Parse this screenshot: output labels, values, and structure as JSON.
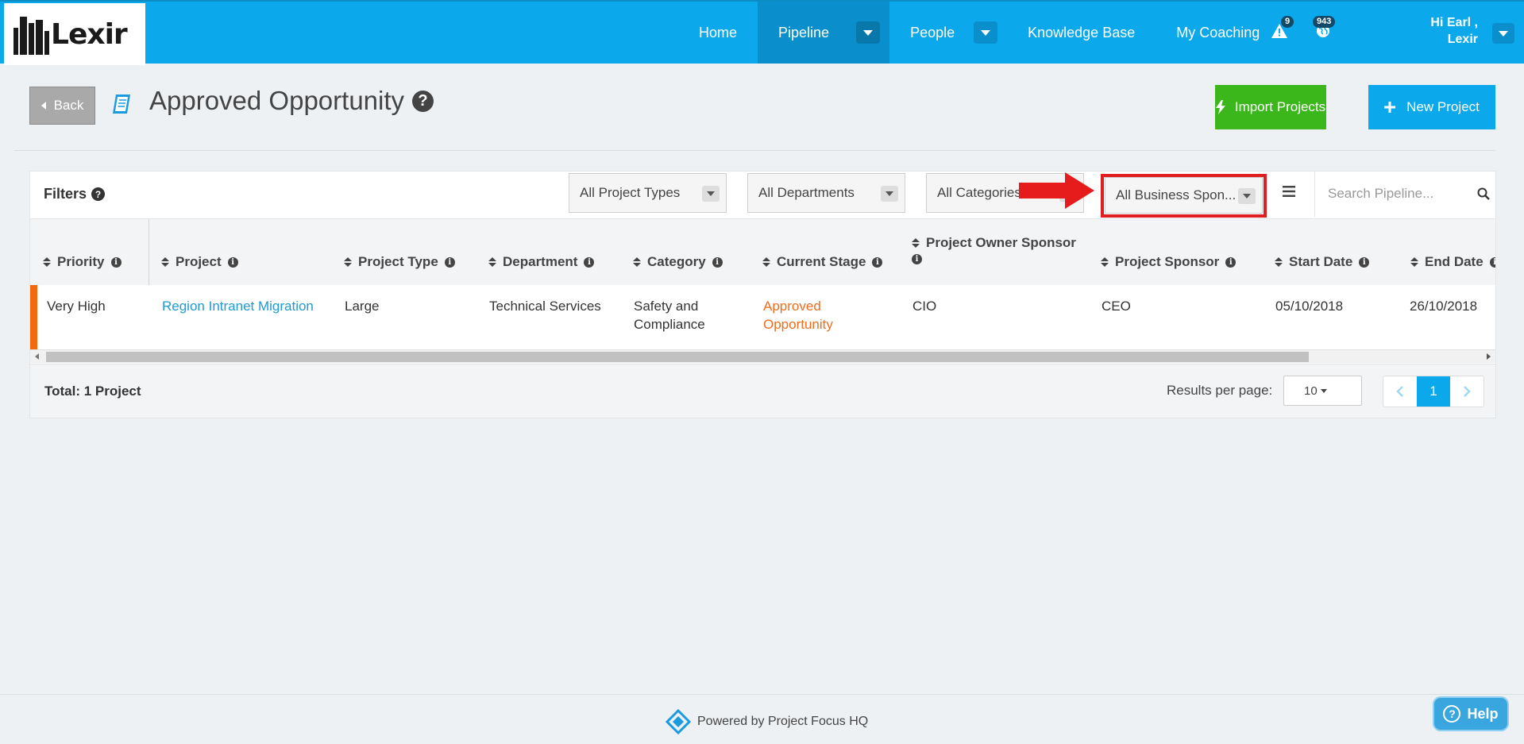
{
  "nav": {
    "logo_text": "Lexir",
    "items": [
      {
        "label": "Home"
      },
      {
        "label": "Pipeline"
      },
      {
        "label": "People"
      },
      {
        "label": "Knowledge Base"
      },
      {
        "label": "My Coaching"
      }
    ],
    "alerts_count": "9",
    "notifications_count": "943",
    "user_greeting_line1": "Hi Earl ,",
    "user_greeting_line2": "Lexir"
  },
  "header": {
    "back_label": "Back",
    "title": "Approved Opportunity",
    "import_label": "Import Projects",
    "new_label": "New Project"
  },
  "filters": {
    "label": "Filters",
    "project_types": "All Project Types",
    "departments": "All Departments",
    "categories": "All Categories",
    "business_sponsor": "All Business Spon...",
    "search_placeholder": "Search Pipeline..."
  },
  "table": {
    "columns": [
      "Priority",
      "Project",
      "Project Type",
      "Department",
      "Category",
      "Current Stage",
      "Project Owner Sponsor",
      "Project Sponsor",
      "Start Date",
      "End Date"
    ],
    "rows": [
      {
        "priority": "Very High",
        "project": "Region Intranet Migration",
        "project_type": "Large",
        "department": "Technical Services",
        "category_line1": "Safety and",
        "category_line2": "Compliance",
        "stage_line1": "Approved",
        "stage_line2": "Opportunity",
        "owner_sponsor": "CIO",
        "project_sponsor": "CEO",
        "start_date": "05/10/2018",
        "end_date": "26/10/2018",
        "priority_color": "#f26a10"
      }
    ],
    "total": "Total: 1 Project",
    "results_label": "Results per page:",
    "results_value": "10",
    "current_page": "1"
  },
  "footer": {
    "powered_by": "Powered by Project Focus HQ",
    "help_label": "Help"
  },
  "colors": {
    "brand": "#0ba8ec",
    "import_green": "#3bb71b",
    "highlight_red": "#e02020",
    "stage_orange": "#f06d1e",
    "link_blue": "#1f9ad6"
  }
}
